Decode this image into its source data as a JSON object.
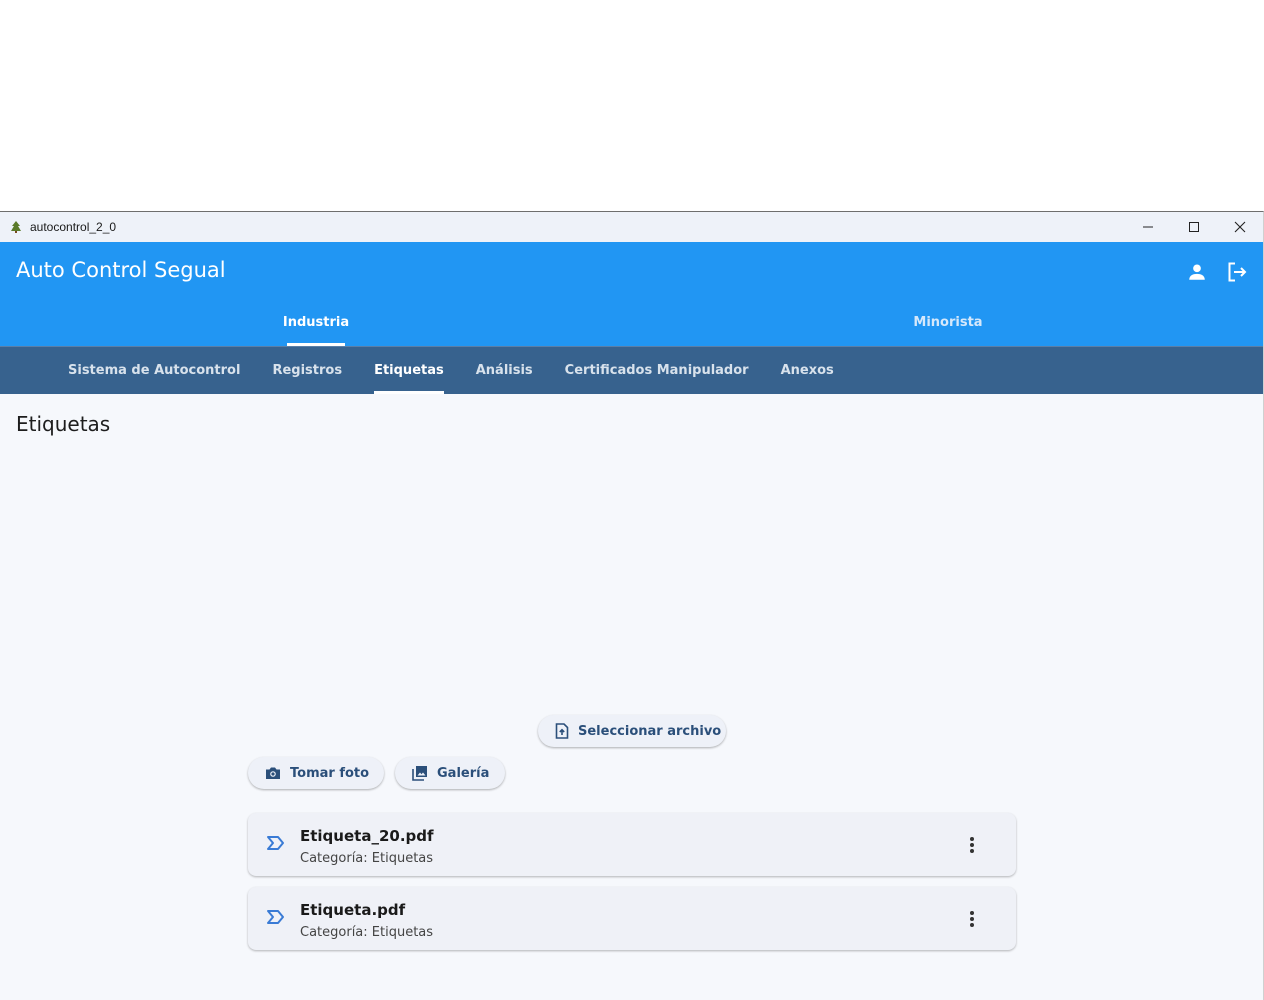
{
  "window": {
    "title": "autocontrol_2_0",
    "controls": [
      "minimize-icon",
      "maximize-icon",
      "close-icon"
    ]
  },
  "appbar": {
    "title": "Auto Control Segual",
    "actions": [
      "person-icon",
      "logout-icon"
    ],
    "color": "#2196f3"
  },
  "main_tabs": [
    {
      "label": "Industria",
      "active": true
    },
    {
      "label": "Minorista",
      "active": false
    }
  ],
  "sub_tabs": [
    {
      "label": "Sistema de Autocontrol",
      "active": false
    },
    {
      "label": "Registros",
      "active": false
    },
    {
      "label": "Etiquetas",
      "active": true
    },
    {
      "label": "Análisis",
      "active": false
    },
    {
      "label": "Certificados Manipulador",
      "active": false
    },
    {
      "label": "Anexos",
      "active": false
    }
  ],
  "page": {
    "title": "Etiquetas"
  },
  "buttons": {
    "select_file": "Seleccionar archivo",
    "take_photo": "Tomar foto",
    "gallery": "Galería"
  },
  "files": [
    {
      "name": "Etiqueta_20.pdf",
      "category": "Categoría: Etiquetas",
      "icon": "label-icon"
    },
    {
      "name": "Etiqueta.pdf",
      "category": "Categoría: Etiquetas",
      "icon": "label-icon"
    }
  ]
}
